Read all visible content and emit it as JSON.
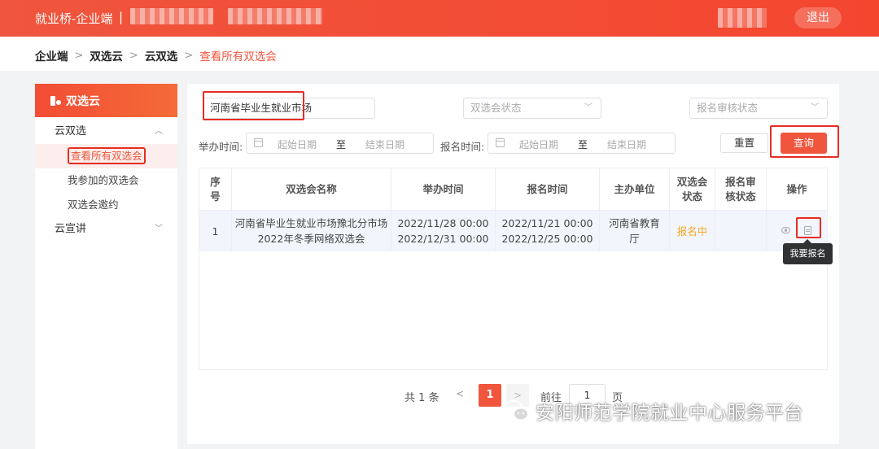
{
  "header": {
    "brand": "就业桥-企业端",
    "divider": "|",
    "logout_label": "退出"
  },
  "breadcrumb": {
    "items": [
      "企业端",
      "双选云",
      "云双选"
    ],
    "current": "查看所有双选会",
    "separator": ">"
  },
  "sidebar": {
    "title": "双选云",
    "groups": [
      {
        "label": "云双选",
        "expanded": true,
        "items": [
          "查看所有双选会",
          "我参加的双选会",
          "双选会邀约"
        ]
      },
      {
        "label": "云宣讲",
        "expanded": false
      }
    ],
    "active_item": "查看所有双选会"
  },
  "filters": {
    "name_value": "河南省毕业生就业市场",
    "status_placeholder": "双选会状态",
    "review_placeholder": "报名审核状态",
    "hold_time_label": "举办时间:",
    "signup_time_label": "报名时间:",
    "start_placeholder": "起始日期",
    "range_separator": "至",
    "end_placeholder": "结束日期",
    "reset_label": "重置",
    "query_label": "查询"
  },
  "table": {
    "columns": [
      "序号",
      "双选会名称",
      "举办时间",
      "报名时间",
      "主办单位",
      "双选会状态",
      "报名审核状态",
      "操作"
    ],
    "col_seq": [
      "序",
      "号"
    ],
    "col_status": [
      "双选会",
      "状态"
    ],
    "col_review": [
      "报名审",
      "核状态"
    ],
    "rows": [
      {
        "seq": "1",
        "name_line1": "河南省毕业生就业市场豫北分市场",
        "name_line2": "2022年冬季网络双选会",
        "hold_start": "2022/11/28 00:00",
        "hold_end": "2022/12/31 00:00",
        "signup_start": "2022/11/21 00:00",
        "signup_end": "2022/12/25 00:00",
        "organizer_line1": "河南省教育",
        "organizer_line2": "厅",
        "status": "报名中",
        "review_status": ""
      }
    ],
    "tooltip": "我要报名"
  },
  "pagination": {
    "total": "共 1 条",
    "prev": "<",
    "current_page": "1",
    "next": ">",
    "goto_label": "前往",
    "goto_value": "1",
    "page_suffix": "页"
  },
  "watermark": "安阳师范学院就业中心服务平台",
  "colors": {
    "accent": "#f0553d",
    "annotation": "#e62d24",
    "status_orange": "#f5a623"
  }
}
